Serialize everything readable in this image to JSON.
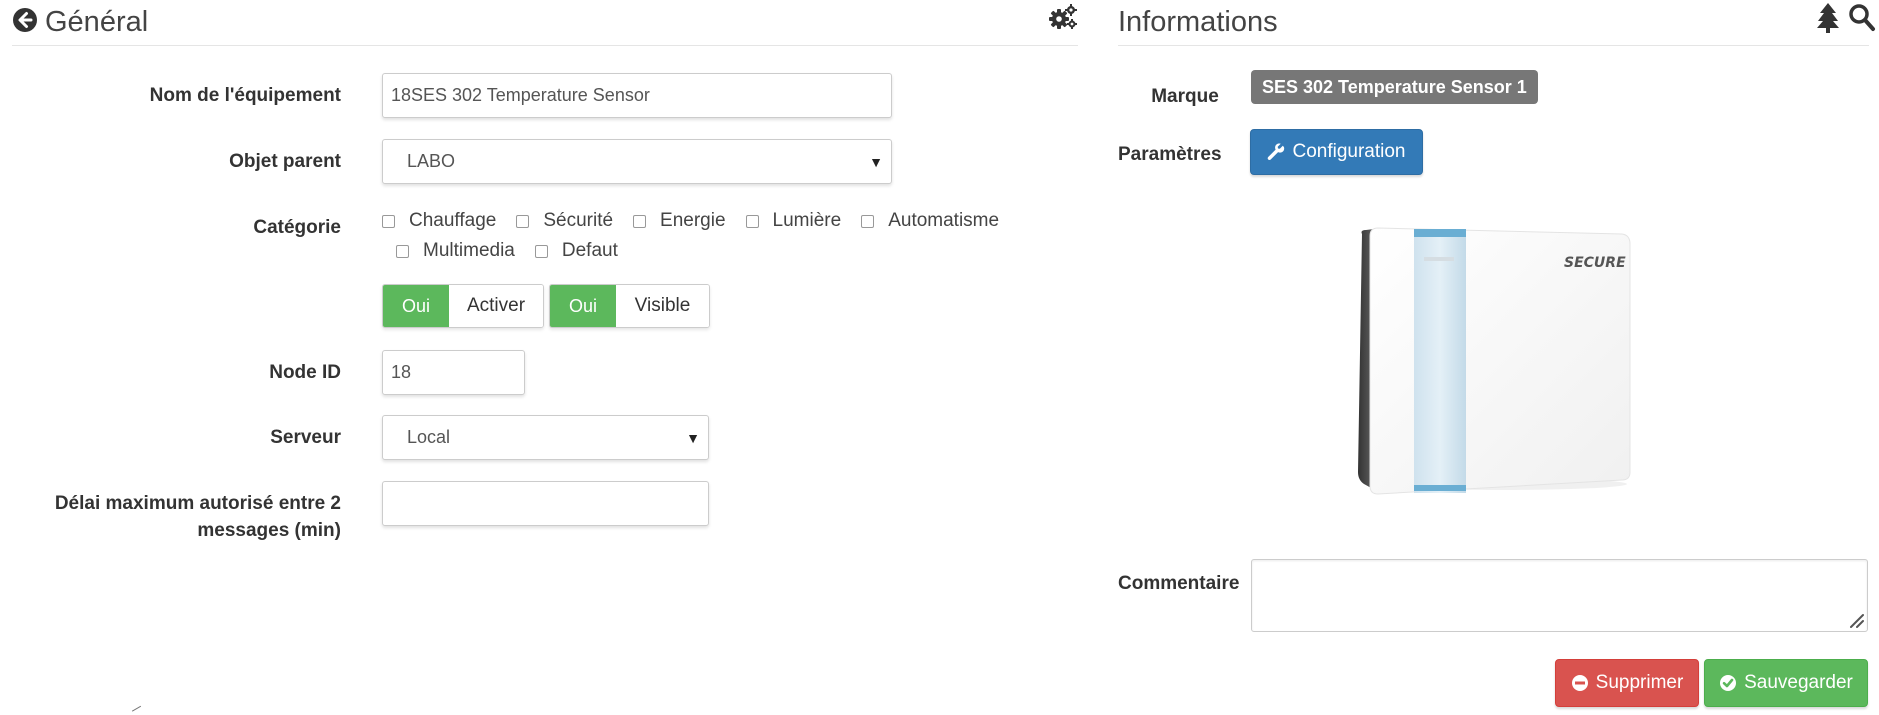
{
  "general": {
    "title": "Général",
    "back_icon": "circle-arrow-left-icon",
    "settings_icon": "cogs-icon",
    "fields": {
      "name_label": "Nom de l'équipement",
      "name_value": "18SES 302 Temperature Sensor",
      "parent_label": "Objet parent",
      "parent_value": "LABO",
      "category_label": "Catégorie",
      "categories": [
        "Chauffage",
        "Sécurité",
        "Energie",
        "Lumière",
        "Automatisme",
        "Multimedia",
        "Defaut"
      ],
      "enable_on": "Oui",
      "enable_label": "Activer",
      "visible_on": "Oui",
      "visible_label": "Visible",
      "node_label": "Node ID",
      "node_value": "18",
      "server_label": "Serveur",
      "server_value": "Local",
      "delay_label_line1": "Délai maximum autorisé entre 2",
      "delay_label_line2": "messages (min)",
      "delay_value": ""
    }
  },
  "informations": {
    "title": "Informations",
    "tree_icon": "tree-icon",
    "search_icon": "search-icon",
    "brand_label": "Marque",
    "brand_value": "SES 302 Temperature Sensor 1",
    "params_label": "Paramètres",
    "config_button": "Configuration",
    "device_logo_text": "SECURE",
    "comment_label": "Commentaire",
    "comment_value": "",
    "delete_button": "Supprimer",
    "save_button": "Sauvegarder"
  },
  "colors": {
    "success": "#5cb85c",
    "primary": "#337ab7",
    "danger": "#d9534f",
    "badge": "#777777"
  }
}
